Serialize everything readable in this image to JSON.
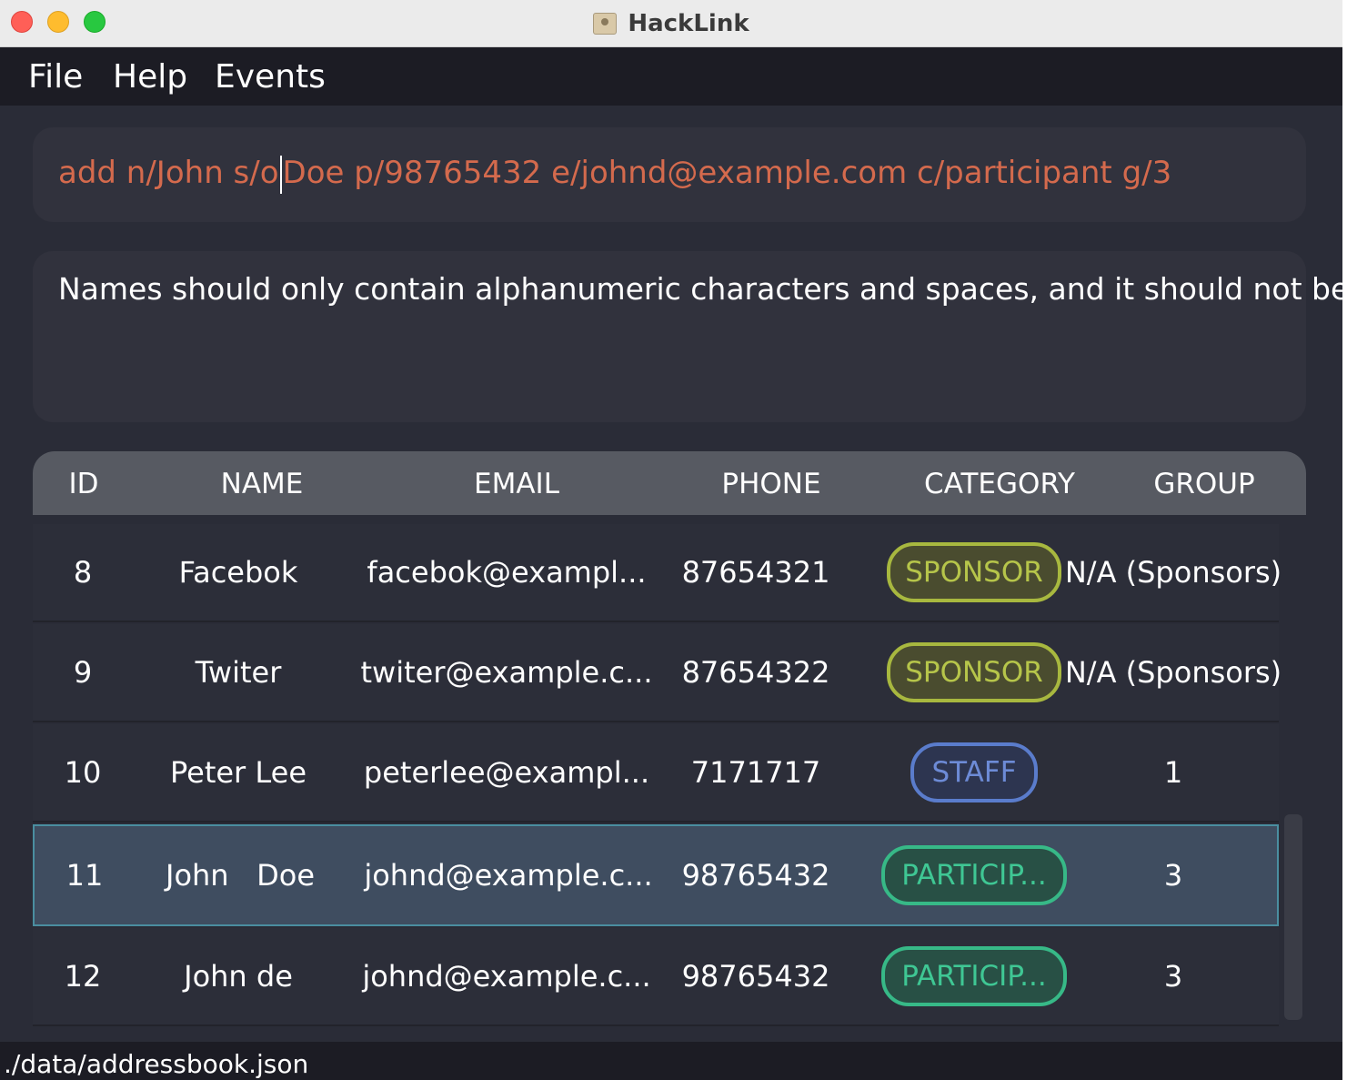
{
  "window": {
    "title": "HackLink"
  },
  "menu": {
    "items": [
      "File",
      "Help",
      "Events"
    ]
  },
  "command": {
    "before_caret": "add n/John s/o",
    "after_caret": "Doe p/98765432 e/johnd@example.com c/participant g/3"
  },
  "result": {
    "message": "Names should only contain alphanumeric characters and spaces, and it should not be blank"
  },
  "table": {
    "columns": [
      "ID",
      "NAME",
      "EMAIL",
      "PHONE",
      "CATEGORY",
      "GROUP"
    ],
    "rows": [
      {
        "id": "8",
        "name": "Facebok",
        "email": "facebok@exampl...",
        "phone": "87654321",
        "category": "SPONSOR",
        "group": "N/A (Sponsors)"
      },
      {
        "id": "9",
        "name": "Twiter",
        "email": "twiter@example.c...",
        "phone": "87654322",
        "category": "SPONSOR",
        "group": "N/A (Sponsors)"
      },
      {
        "id": "10",
        "name": "Peter Lee",
        "email": "peterlee@exampl...",
        "phone": "7171717",
        "category": "STAFF",
        "group": "1"
      },
      {
        "id": "11",
        "name": "John   Doe",
        "email": "johnd@example.c...",
        "phone": "98765432",
        "category": "PARTICIP...",
        "group": "3"
      },
      {
        "id": "12",
        "name": "John de",
        "email": "johnd@example.c...",
        "phone": "98765432",
        "category": "PARTICIP...",
        "group": "3"
      }
    ],
    "selected_row_id": "11"
  },
  "status": {
    "path": "./data/addressbook.json"
  },
  "colors": {
    "command_text": "#d46a4d",
    "sponsor": "#b6c54a",
    "staff": "#6d8bd6",
    "participant": "#3fc794",
    "selection": "#3f4d60"
  }
}
